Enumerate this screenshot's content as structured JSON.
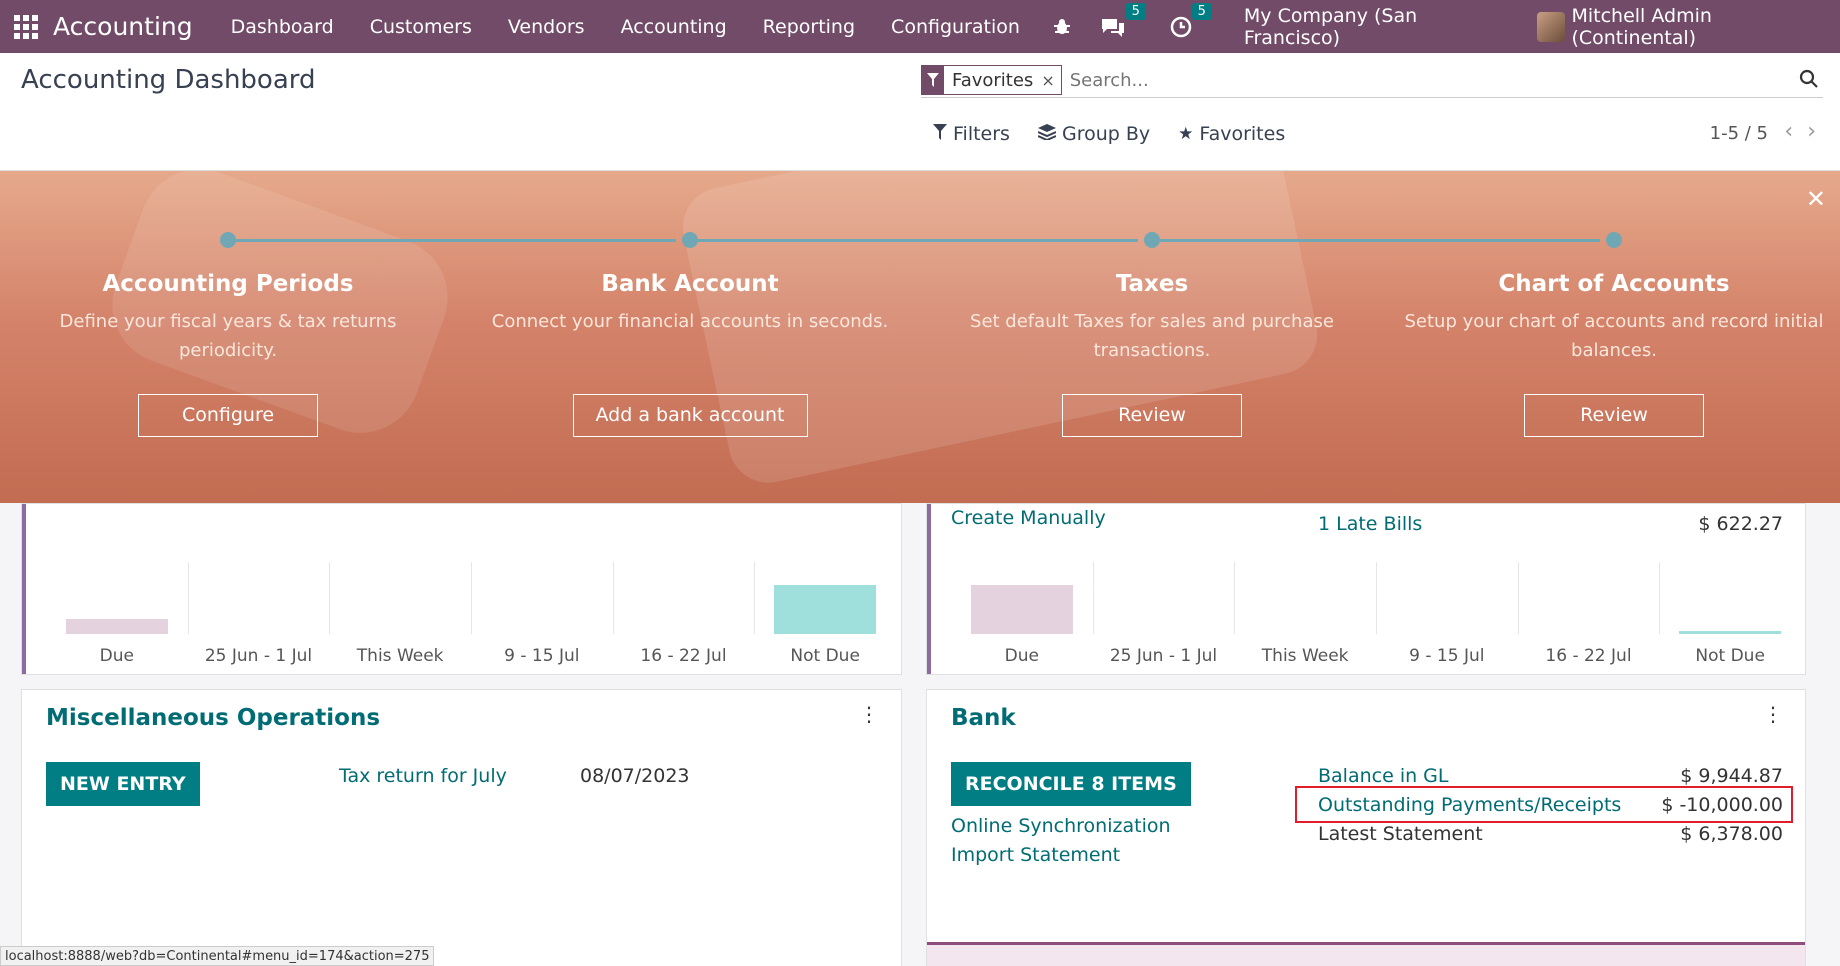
{
  "navbar": {
    "app_name": "Accounting",
    "menu": [
      "Dashboard",
      "Customers",
      "Vendors",
      "Accounting",
      "Reporting",
      "Configuration"
    ],
    "messages_count": "5",
    "activities_count": "5",
    "company": "My Company (San Francisco)",
    "user": "Mitchell Admin (Continental)"
  },
  "control": {
    "title": "Accounting Dashboard",
    "facet_label": "Favorites",
    "search_placeholder": "Search...",
    "filters_label": "Filters",
    "groupby_label": "Group By",
    "favorites_label": "Favorites",
    "pager": "1-5 / 5"
  },
  "banner": {
    "steps": [
      {
        "title": "Accounting Periods",
        "desc": "Define your fiscal years & tax returns periodicity.",
        "button": "Configure"
      },
      {
        "title": "Bank Account",
        "desc": "Connect your financial accounts in seconds.",
        "button": "Add a bank account"
      },
      {
        "title": "Taxes",
        "desc": "Set default Taxes for sales and purchase transactions.",
        "button": "Review"
      },
      {
        "title": "Chart of Accounts",
        "desc": "Setup your chart of accounts and record initial balances.",
        "button": "Review"
      }
    ]
  },
  "left_chart_card": {
    "chart_data": {
      "type": "bar",
      "categories": [
        "Due",
        "25 Jun - 1 Jul",
        "This Week",
        "9 - 15 Jul",
        "16 - 22 Jul",
        "Not Due"
      ],
      "values": [
        0.3,
        0,
        0,
        0,
        0,
        1
      ]
    }
  },
  "right_chart_card": {
    "create_manually": "Create Manually",
    "late_bills": "1 Late Bills",
    "late_bills_amount": "$ 622.27",
    "chart_data": {
      "type": "bar",
      "categories": [
        "Due",
        "25 Jun - 1 Jul",
        "This Week",
        "9 - 15 Jul",
        "16 - 22 Jul",
        "Not Due"
      ],
      "values": [
        1,
        0,
        0,
        0,
        0,
        0.06
      ]
    }
  },
  "misc": {
    "title": "Miscellaneous Operations",
    "new_entry": "NEW ENTRY",
    "item_label": "Tax return for July",
    "item_date": "08/07/2023"
  },
  "bank": {
    "title": "Bank",
    "reconcile": "RECONCILE 8 ITEMS",
    "online_sync": "Online Synchronization",
    "import_statement": "Import Statement",
    "balance_gl_label": "Balance in GL",
    "balance_gl_value": "$ 9,944.87",
    "outstanding_label": "Outstanding Payments/Receipts",
    "outstanding_value": "$ -10,000.00",
    "latest_label": "Latest Statement",
    "latest_value": "$ 6,378.00"
  },
  "statusbar": "localhost:8888/web?db=Continental#menu_id=174&action=275",
  "colors": {
    "brand": "#714b67",
    "teal": "#017e84",
    "highlight": "#e11d2a",
    "bar_due": "#e4d2df",
    "bar_notdue": "#9fe0dc"
  }
}
